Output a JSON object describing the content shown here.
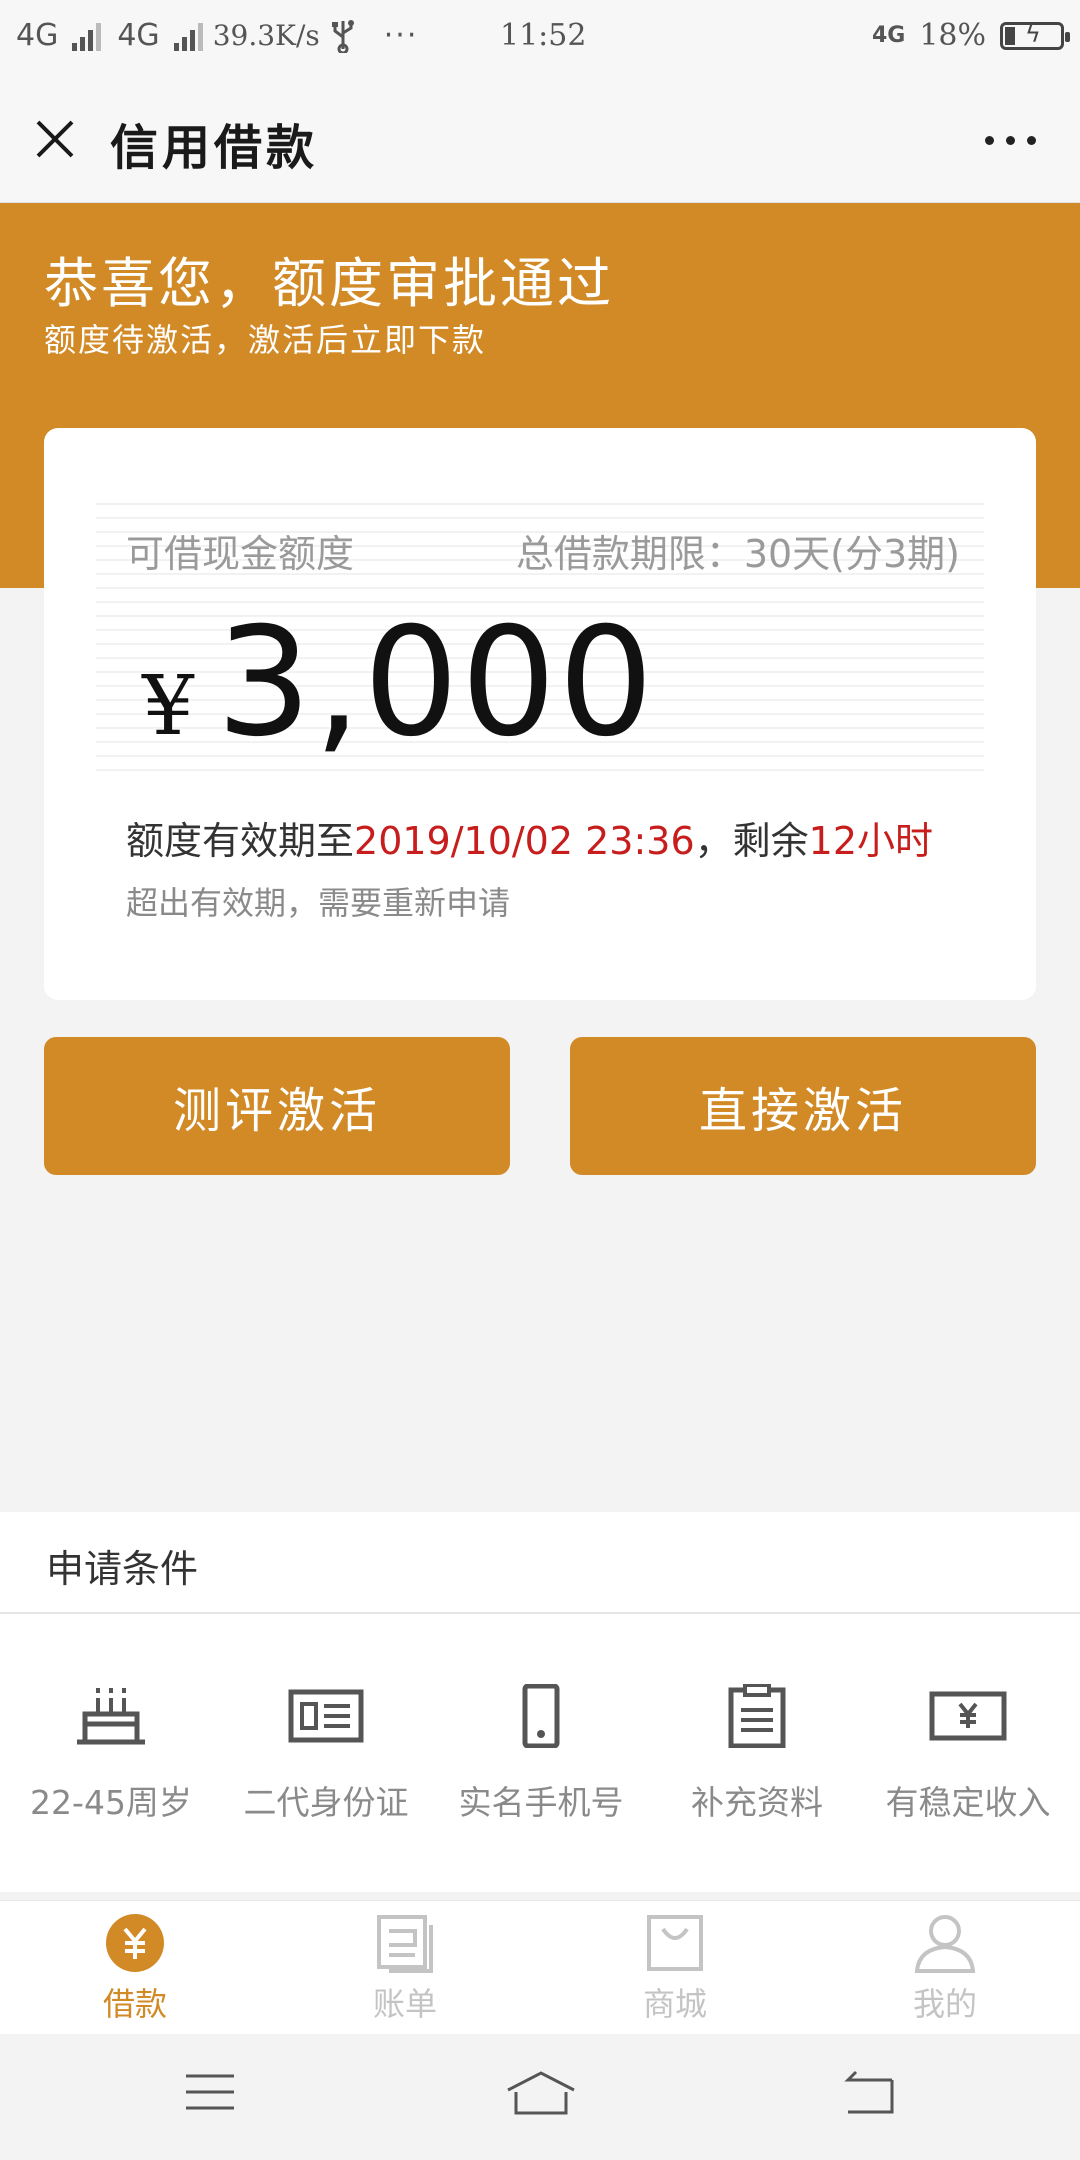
{
  "status_bar": {
    "network1": "4G",
    "network2": "4G",
    "speed": "39.3K/s",
    "overflow": "···",
    "time": "11:52",
    "network_right": "4G",
    "battery": "18%"
  },
  "titlebar": {
    "title": "信用借款"
  },
  "hero": {
    "title": "恭喜您，额度审批通过",
    "subtitle": "额度待激活，激活后立即下款"
  },
  "card": {
    "label_left": "可借现金额度",
    "label_right": "总借款期限：30天(分3期)",
    "currency": "¥",
    "amount": "3,000",
    "validity_prefix": "额度有效期至",
    "validity_date": "2019/10/02 23:36",
    "validity_mid": "，剩余",
    "validity_remaining": "12小时",
    "note": "超出有效期，需要重新申请"
  },
  "buttons": {
    "eval_activate": "测评激活",
    "direct_activate": "直接激活"
  },
  "conditions": {
    "title": "申请条件",
    "items": [
      {
        "label": "22-45周岁",
        "icon": "birthday-cake-icon"
      },
      {
        "label": "二代身份证",
        "icon": "id-card-icon"
      },
      {
        "label": "实名手机号",
        "icon": "phone-icon"
      },
      {
        "label": "补充资料",
        "icon": "clipboard-icon"
      },
      {
        "label": "有稳定收入",
        "icon": "banknote-icon"
      }
    ]
  },
  "tabs": [
    {
      "label": "借款",
      "icon": "yuan-coin-icon",
      "active": true
    },
    {
      "label": "账单",
      "icon": "bill-icon"
    },
    {
      "label": "商城",
      "icon": "shopping-bag-icon"
    },
    {
      "label": "我的",
      "icon": "person-icon"
    }
  ],
  "colors": {
    "brand": "#d18a26",
    "highlight_red": "#c81d1d",
    "tab_inactive": "#c4c4c4"
  }
}
